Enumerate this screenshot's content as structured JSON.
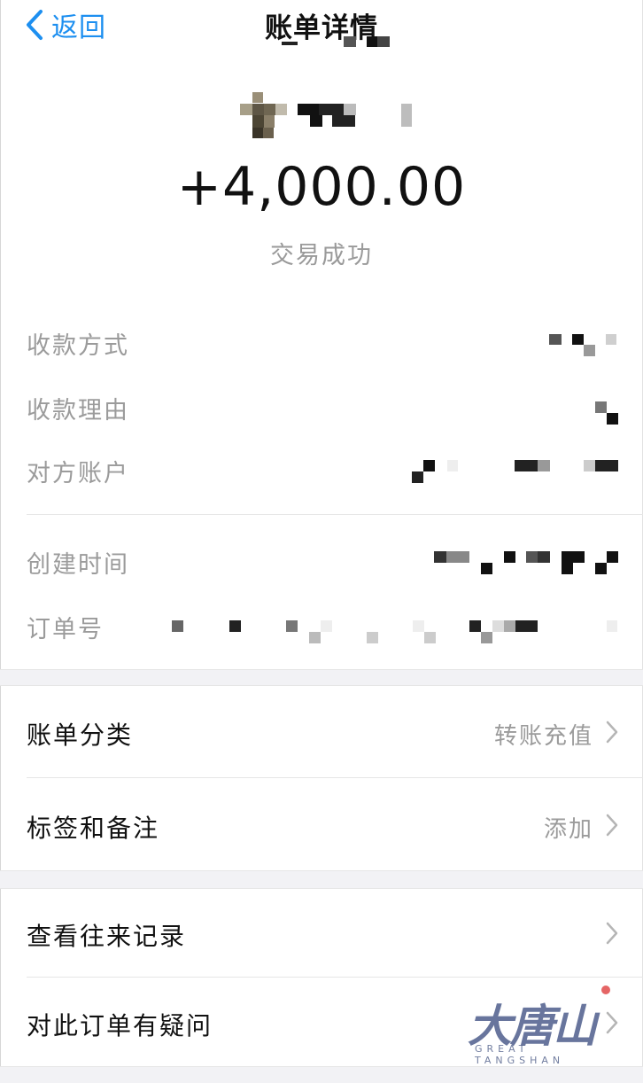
{
  "nav": {
    "back_label": "返回",
    "title": "账单详情"
  },
  "summary": {
    "amount": "+4,000.00",
    "status": "交易成功"
  },
  "details": [
    {
      "label": "收款方式"
    },
    {
      "label": "收款理由"
    },
    {
      "label": "对方账户"
    },
    {
      "label": "创建时间"
    },
    {
      "label": "订单号"
    }
  ],
  "actions": {
    "category": {
      "label": "账单分类",
      "value": "转账充值"
    },
    "tags": {
      "label": "标签和备注",
      "value": "添加"
    },
    "history": {
      "label": "查看往来记录"
    },
    "dispute": {
      "label": "对此订单有疑问"
    }
  },
  "watermark": {
    "main": "大唐山",
    "sub": "GREAT TANGSHAN"
  },
  "colors": {
    "accent": "#1d8ff0",
    "muted_text": "#9b9b9b",
    "section_gap": "#f2f2f5"
  }
}
